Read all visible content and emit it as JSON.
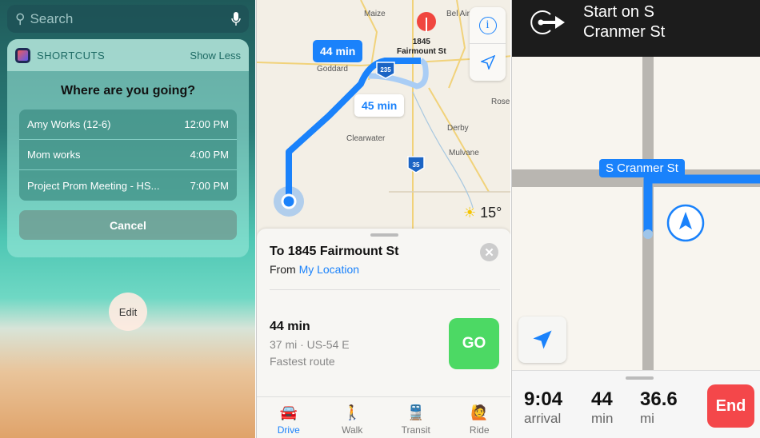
{
  "widget_screen": {
    "search": {
      "placeholder": "Search",
      "icon": "search-icon",
      "mic_icon": "microphone-icon"
    },
    "widget": {
      "app_name": "SHORTCUTS",
      "toggle": "Show Less",
      "question": "Where are you going?",
      "items": [
        {
          "label": "Amy Works (12-6)",
          "time": "12:00 PM"
        },
        {
          "label": "Mom works",
          "time": "4:00 PM"
        },
        {
          "label": "Project Prom Meeting - HS...",
          "time": "7:00 PM"
        }
      ],
      "cancel": "Cancel"
    },
    "edit": "Edit"
  },
  "directions_screen": {
    "map": {
      "places": [
        "Maize",
        "Bel Aire",
        "Goddard",
        "Rose",
        "Derby",
        "Clearwater",
        "Mulvane"
      ],
      "highways": [
        "235",
        "35"
      ],
      "destination": "1845\nFairmount St",
      "route_primary": "44 min",
      "route_alt": "45 min",
      "weather": "15°"
    },
    "sheet": {
      "title": "To 1845 Fairmount St",
      "from_label": "From",
      "from_value": "My Location",
      "duration": "44 min",
      "details": "37 mi · US-54 E",
      "note": "Fastest route",
      "go": "GO"
    },
    "tabs": [
      {
        "label": "Drive",
        "active": true
      },
      {
        "label": "Walk"
      },
      {
        "label": "Transit"
      },
      {
        "label": "Ride"
      }
    ],
    "colors": {
      "accent": "#1a82fb",
      "go": "#4cd964"
    }
  },
  "nav_screen": {
    "instruction": "Start on S Cranmer St",
    "street_label": "S Cranmer St",
    "arrival": "9:04",
    "arrival_label": "arrival",
    "minutes": "44",
    "minutes_label": "min",
    "distance": "36.6",
    "distance_label": "mi",
    "end": "End",
    "colors": {
      "end": "#f4474a"
    }
  }
}
